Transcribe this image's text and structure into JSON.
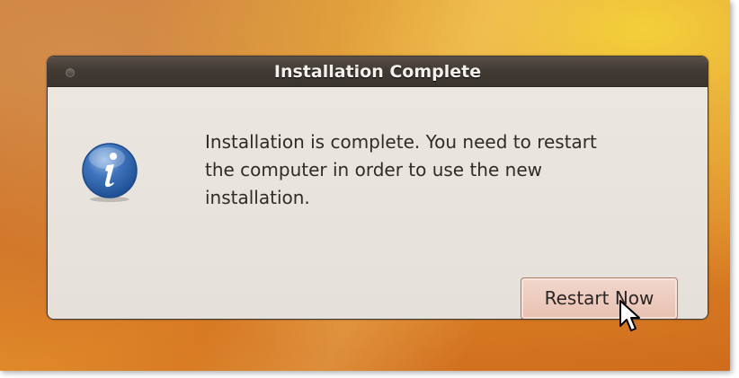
{
  "dialog": {
    "title": "Installation Complete",
    "message": "Installation is complete. You need to restart\nthe computer in order to use the new\ninstallation.",
    "primary_button_label": "Restart Now"
  },
  "icons": {
    "info": "info-icon",
    "cursor": "mouse-pointer-icon",
    "close": "window-close-dot-icon"
  },
  "colors": {
    "titlebar": "#3c3b37",
    "dialog_bg": "#ede8e2",
    "button_bg": "#ecc8ba",
    "wallpaper_accent": "#e0892a"
  }
}
